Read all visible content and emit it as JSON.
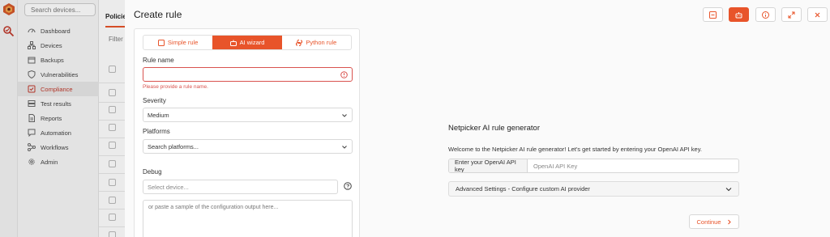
{
  "sidebar": {
    "search_placeholder": "Search devices...",
    "items": [
      {
        "label": "Dashboard",
        "icon": "dashboard-icon"
      },
      {
        "label": "Devices",
        "icon": "devices-icon"
      },
      {
        "label": "Backups",
        "icon": "backups-icon"
      },
      {
        "label": "Vulnerabilities",
        "icon": "shield-icon"
      },
      {
        "label": "Compliance",
        "icon": "compliance-icon",
        "active": true
      },
      {
        "label": "Test results",
        "icon": "test-results-icon"
      },
      {
        "label": "Reports",
        "icon": "reports-icon"
      },
      {
        "label": "Automation",
        "icon": "automation-icon"
      },
      {
        "label": "Workflows",
        "icon": "workflows-icon"
      },
      {
        "label": "Admin",
        "icon": "gear-icon"
      }
    ]
  },
  "policies": {
    "tab_label": "Policies",
    "filter_label": "Filter"
  },
  "modal": {
    "title": "Create rule",
    "tabs": [
      {
        "label": "Simple rule",
        "icon": "simple-rule-icon"
      },
      {
        "label": "AI wizard",
        "icon": "robot-icon",
        "active": true
      },
      {
        "label": "Python rule",
        "icon": "python-icon"
      }
    ],
    "form": {
      "rule_name_label": "Rule name",
      "rule_name_value": "",
      "rule_name_error": "Please provide a rule name.",
      "severity_label": "Severity",
      "severity_value": "Medium",
      "platforms_label": "Platforms",
      "platforms_placeholder": "Search platforms...",
      "debug_label": "Debug",
      "debug_device_placeholder": "Select device...",
      "debug_config_placeholder": "or paste a sample of the configuration output here..."
    },
    "generator": {
      "title": "Netpicker AI rule generator",
      "welcome": "Welcome to the Netpicker AI rule generator! Let's get started by entering your OpenAI API key.",
      "api_label": "Enter your OpenAI API key",
      "api_placeholder": "OpenAI API Key",
      "advanced_label": "Advanced Settings - Configure custom AI provider",
      "continue_label": "Continue"
    }
  },
  "colors": {
    "accent": "#e8542a",
    "error": "#d9534f"
  }
}
